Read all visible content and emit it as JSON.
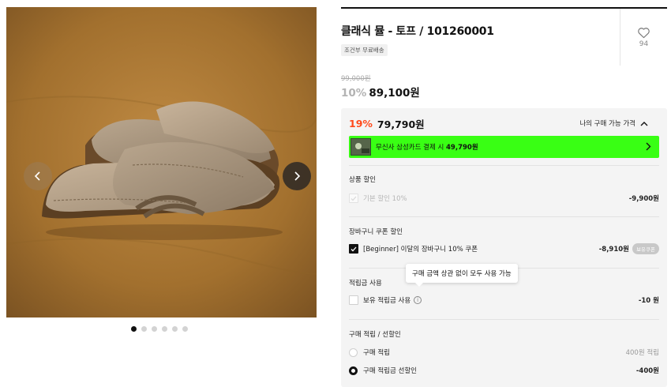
{
  "product": {
    "title": "클래식 뮬 - 토프 / 101260001",
    "shipping_badge": "조건부 무료배송",
    "likes": "94"
  },
  "gallery": {
    "image_count": 6,
    "active_index": 0
  },
  "pricing": {
    "original_price": "99,000원",
    "discount_rate": "10%",
    "sale_price": "89,100원"
  },
  "benefit_panel": {
    "best_rate": "19%",
    "best_price": "79,790원",
    "caption": "나의 구매 가능 가격",
    "card_banner_prefix": "무신사 삼성카드 결제 시 ",
    "card_banner_price": "49,790원"
  },
  "product_discount": {
    "title": "상품 할인",
    "label": "기본 할인 10%",
    "amount": "-9,900원"
  },
  "cart_coupon": {
    "title": "장바구니 쿠폰 할인",
    "label": "[Beginner] 이달의 장바구니 10% 쿠폰",
    "amount": "-8,910원",
    "pill": "보유쿠폰"
  },
  "points": {
    "title": "적립금 사용",
    "label": "보유 적립금 사용",
    "info_glyph": "i",
    "amount": "-10 원",
    "tooltip": "구매 금액 상관 없이 모두 사용 가능"
  },
  "purchase_reward": {
    "title": "구매 적립 / 선할인",
    "option_earn": "구매 적립",
    "option_earn_amount": "400원 적립",
    "option_prediscount": "구매 적립금 선할인",
    "option_prediscount_amount": "-400원",
    "selected": "prediscount"
  },
  "colors": {
    "accent_orange": "#ff4a1c",
    "banner_green": "#39ff14",
    "panel_bg": "#f4f4f4"
  }
}
